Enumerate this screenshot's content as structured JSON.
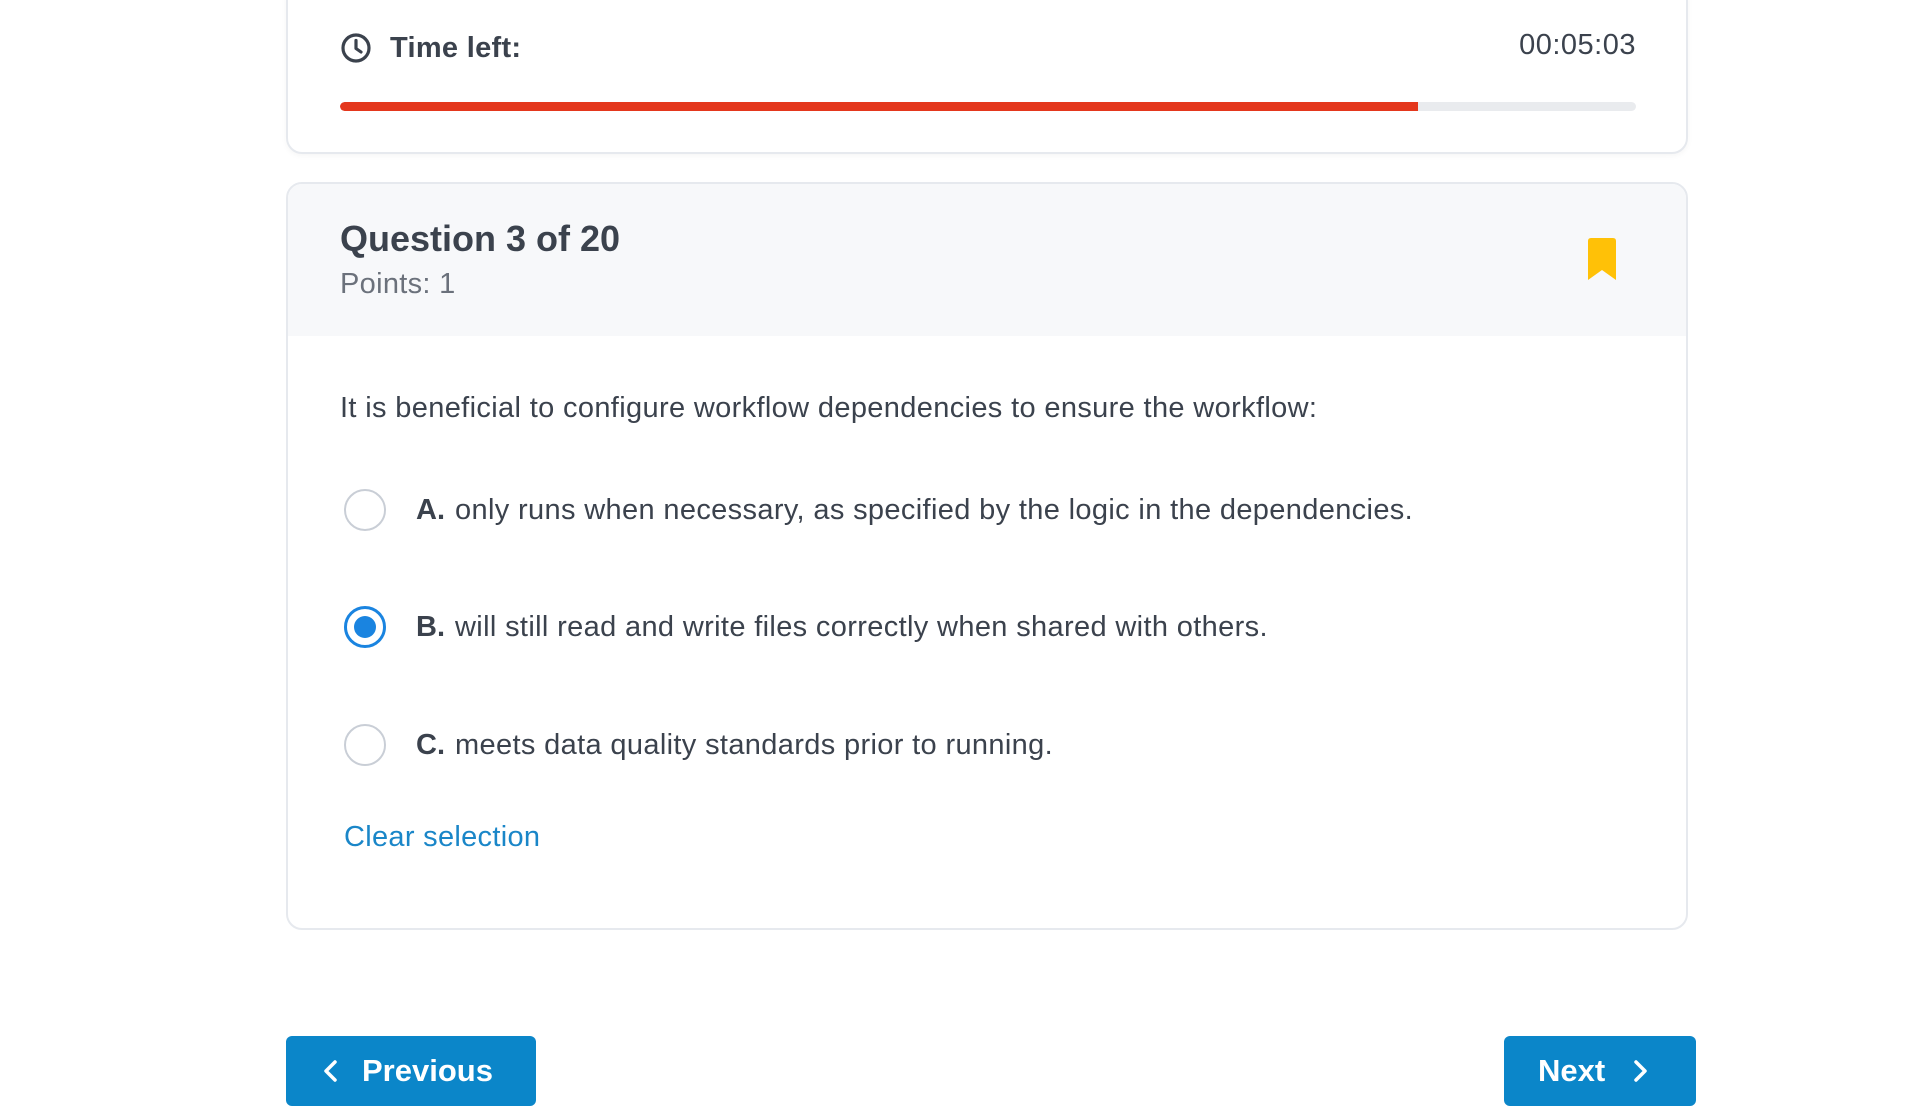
{
  "timer": {
    "label": "Time left:",
    "value": "00:05:03",
    "progress_fraction": 0.832,
    "progress_color": "#e4371d",
    "icon": "clock-icon"
  },
  "question": {
    "title": "Question 3 of 20",
    "points": "Points: 1",
    "bookmark_icon": "bookmark-icon",
    "bookmark_color": "#ffc107",
    "text": "It is beneficial to configure workflow dependencies to ensure the workflow:",
    "options": [
      {
        "letter": "A.",
        "text": "only runs when necessary, as specified by the logic in the dependencies.",
        "selected": false
      },
      {
        "letter": "B.",
        "text": "will still read and write files correctly when shared with others.",
        "selected": true
      },
      {
        "letter": "C.",
        "text": "meets data quality standards prior to running.",
        "selected": false
      }
    ],
    "clear_label": "Clear selection"
  },
  "navigation": {
    "previous_label": "Previous",
    "next_label": "Next"
  },
  "colors": {
    "accent_blue": "#0b86c9",
    "radio_selected": "#1a84e0",
    "link": "#1a86c8"
  }
}
